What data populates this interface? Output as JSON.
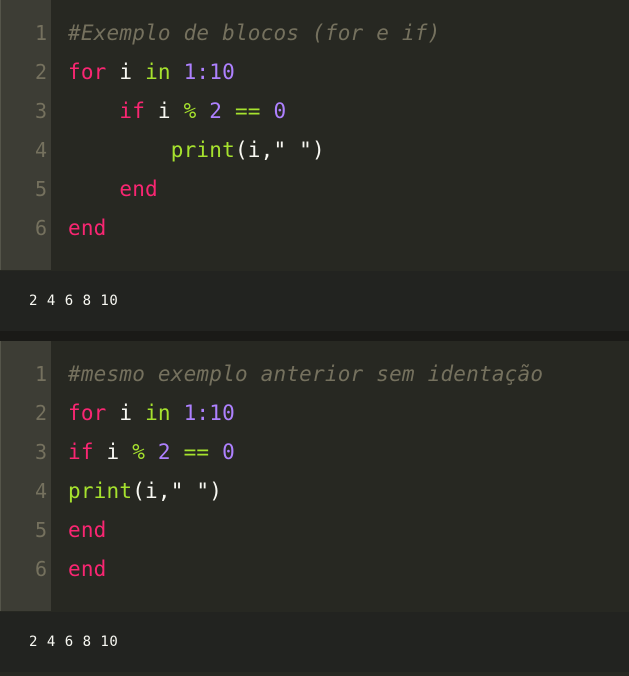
{
  "cells": [
    {
      "lines": [
        {
          "n": "1",
          "tokens": [
            {
              "t": "#Exemplo de blocos (for e if)",
              "c": "comment"
            }
          ]
        },
        {
          "n": "2",
          "tokens": [
            {
              "t": "for",
              "c": "kw"
            },
            {
              "t": " i ",
              "c": "id"
            },
            {
              "t": "in",
              "c": "in"
            },
            {
              "t": " ",
              "c": "id"
            },
            {
              "t": "1:10",
              "c": "num"
            }
          ]
        },
        {
          "n": "3",
          "tokens": [
            {
              "t": "    ",
              "c": "id"
            },
            {
              "t": "if",
              "c": "kw"
            },
            {
              "t": " i ",
              "c": "id"
            },
            {
              "t": "%",
              "c": "op"
            },
            {
              "t": " ",
              "c": "id"
            },
            {
              "t": "2",
              "c": "num"
            },
            {
              "t": " ",
              "c": "id"
            },
            {
              "t": "==",
              "c": "op"
            },
            {
              "t": " ",
              "c": "id"
            },
            {
              "t": "0",
              "c": "num"
            }
          ]
        },
        {
          "n": "4",
          "tokens": [
            {
              "t": "        ",
              "c": "id"
            },
            {
              "t": "print",
              "c": "fn"
            },
            {
              "t": "(i,\" \")",
              "c": "punct"
            }
          ]
        },
        {
          "n": "5",
          "tokens": [
            {
              "t": "    ",
              "c": "id"
            },
            {
              "t": "end",
              "c": "kw"
            }
          ]
        },
        {
          "n": "6",
          "tokens": [
            {
              "t": "end",
              "c": "kw"
            }
          ]
        }
      ],
      "output": "2 4 6 8 10"
    },
    {
      "lines": [
        {
          "n": "1",
          "tokens": [
            {
              "t": "#mesmo exemplo anterior sem identação",
              "c": "comment"
            }
          ]
        },
        {
          "n": "2",
          "tokens": [
            {
              "t": "for",
              "c": "kw"
            },
            {
              "t": " i ",
              "c": "id"
            },
            {
              "t": "in",
              "c": "in"
            },
            {
              "t": " ",
              "c": "id"
            },
            {
              "t": "1:10",
              "c": "num"
            }
          ]
        },
        {
          "n": "3",
          "tokens": [
            {
              "t": "if",
              "c": "kw"
            },
            {
              "t": " i ",
              "c": "id"
            },
            {
              "t": "%",
              "c": "op"
            },
            {
              "t": " ",
              "c": "id"
            },
            {
              "t": "2",
              "c": "num"
            },
            {
              "t": " ",
              "c": "id"
            },
            {
              "t": "==",
              "c": "op"
            },
            {
              "t": " ",
              "c": "id"
            },
            {
              "t": "0",
              "c": "num"
            }
          ]
        },
        {
          "n": "4",
          "tokens": [
            {
              "t": "print",
              "c": "fn"
            },
            {
              "t": "(i,\" \")",
              "c": "punct"
            }
          ]
        },
        {
          "n": "5",
          "tokens": [
            {
              "t": "end",
              "c": "kw"
            }
          ]
        },
        {
          "n": "6",
          "tokens": [
            {
              "t": "end",
              "c": "kw"
            }
          ]
        }
      ],
      "output": "2 4 6 8 10"
    }
  ],
  "colors": {
    "background": "#272822",
    "gutter": "#3d3d35",
    "comment": "#75715e",
    "keyword": "#f92672",
    "function": "#a6e22e",
    "number": "#ae81ff",
    "text": "#f8f8f2"
  }
}
